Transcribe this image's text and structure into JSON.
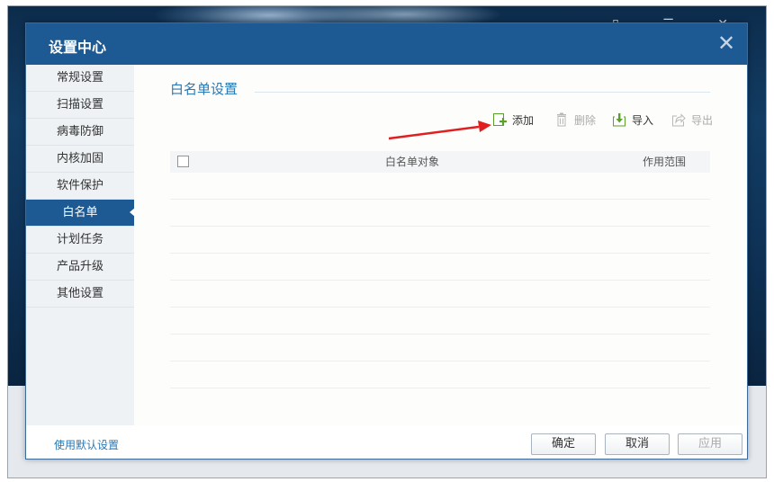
{
  "background": {
    "title_icons": "▯ ☰ ✕"
  },
  "dialog": {
    "title": "设置中心",
    "close_icon": "✕"
  },
  "sidebar": {
    "items": [
      {
        "label": "常规设置",
        "active": false
      },
      {
        "label": "扫描设置",
        "active": false
      },
      {
        "label": "病毒防御",
        "active": false
      },
      {
        "label": "内核加固",
        "active": false
      },
      {
        "label": "软件保护",
        "active": false
      },
      {
        "label": "白名单",
        "active": true
      },
      {
        "label": "计划任务",
        "active": false
      },
      {
        "label": "产品升级",
        "active": false
      },
      {
        "label": "其他设置",
        "active": false
      }
    ]
  },
  "main": {
    "section_title": "白名单设置",
    "toolbar": {
      "add_label": "添加",
      "delete_label": "删除",
      "import_label": "导入",
      "export_label": "导出"
    },
    "table": {
      "col_object": "白名单对象",
      "col_scope": "作用范围",
      "rows": []
    }
  },
  "footer": {
    "default_link": "使用默认设置",
    "ok_label": "确定",
    "cancel_label": "取消",
    "apply_label": "应用"
  },
  "colors": {
    "accent": "#1d5a93",
    "link": "#2a78b5",
    "annotation_arrow": "#e02020",
    "add_icon": "#5aa02c"
  }
}
